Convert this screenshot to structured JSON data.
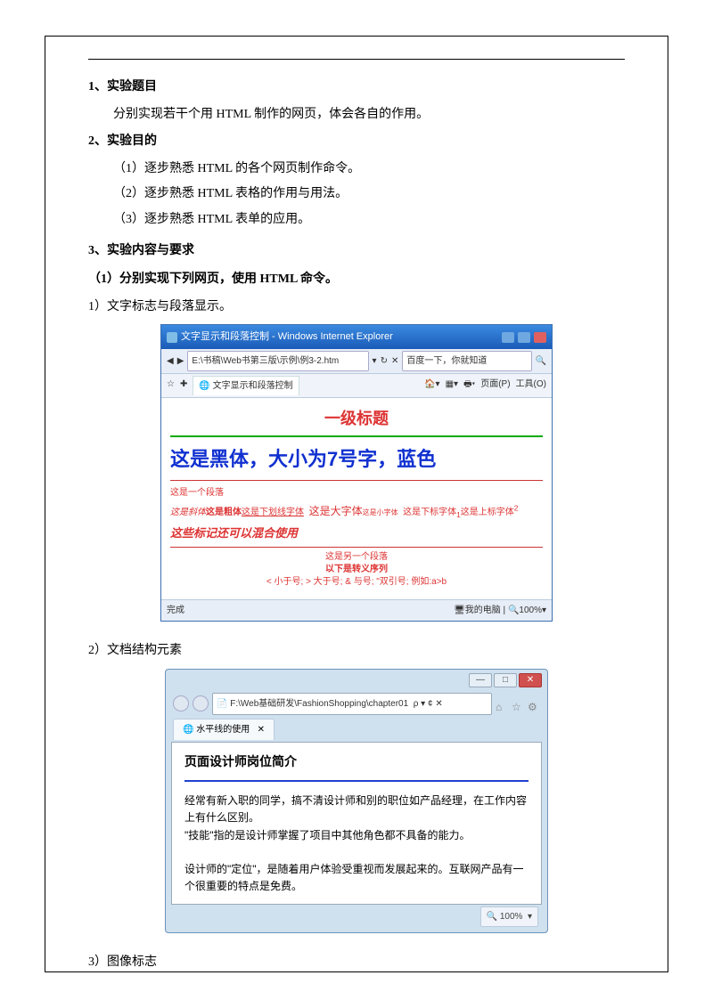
{
  "sections": {
    "s1_title": "1、实验题目",
    "s1_body": "分别实现若干个用 HTML 制作的网页，体会各自的作用。",
    "s2_title": "2、实验目的",
    "s2_items": [
      "（1）逐步熟悉  HTML 的各个网页制作命令。",
      "（2）逐步熟悉 HTML 表格的作用与用法。",
      "（3）逐步熟悉 HTML 表单的应用。"
    ],
    "s3_title": "3、实验内容与要求",
    "s3_sub1": "（1）分别实现下列网页，使用 HTML 命令。",
    "item1": "1）文字标志与段落显示。",
    "item2": "2）文档结构元素",
    "item3": "3）图像标志"
  },
  "shot1": {
    "window_title": "文字显示和段落控制 - Windows Internet Explorer",
    "address": "E:\\书稿\\Web书第三版\\示例\\例3-2.htm",
    "search_hint": "百度一下，你就知道",
    "tab": "文字显示和段落控制",
    "menu_page": "页面(P)",
    "menu_tools": "工具(O)",
    "h1": "一级标题",
    "big_blue": "这是黑体，大小为7号字，蓝色",
    "p_start": "这是一个段落",
    "p_ital": "这是斜体",
    "p_bold": "这是粗体",
    "p_ul": "这是下划线字体",
    "p_big": "这是大字体",
    "p_small": "这是小字体",
    "p_sub": "这是下标字体",
    "p_sup_prefix": "这是上标字体",
    "p_sup": "2",
    "mix": "这些标记还可以混合使用",
    "p2_a": "这是另一个段落",
    "p2_b": "以下是转义序列",
    "p2_c": "< 小于号; > 大于号; & 与号; \"双引号; 例如:a>b",
    "status_done": "完成",
    "status_pc": "我的电脑",
    "zoom": "100%"
  },
  "shot2": {
    "url": "F:\\Web基础研发\\FashionShopping\\chapter01",
    "url_suffix": "ρ ▾ ¢ ✕",
    "tab": "水平线的使用",
    "title": "页面设计师岗位简介",
    "p1": "经常有新入职的同学，搞不清设计师和别的职位如产品经理，在工作内容上有什么区别。",
    "p2": "\"技能\"指的是设计师掌握了项目中其他角色都不具备的能力。",
    "p3": "设计师的\"定位\"，是随着用户体验受重视而发展起来的。互联网产品有一个很重要的特点是免费。",
    "zoom": "100%",
    "min": "—",
    "max": "□",
    "close": "✕",
    "home": "⌂",
    "star": "☆",
    "gear": "⚙"
  }
}
